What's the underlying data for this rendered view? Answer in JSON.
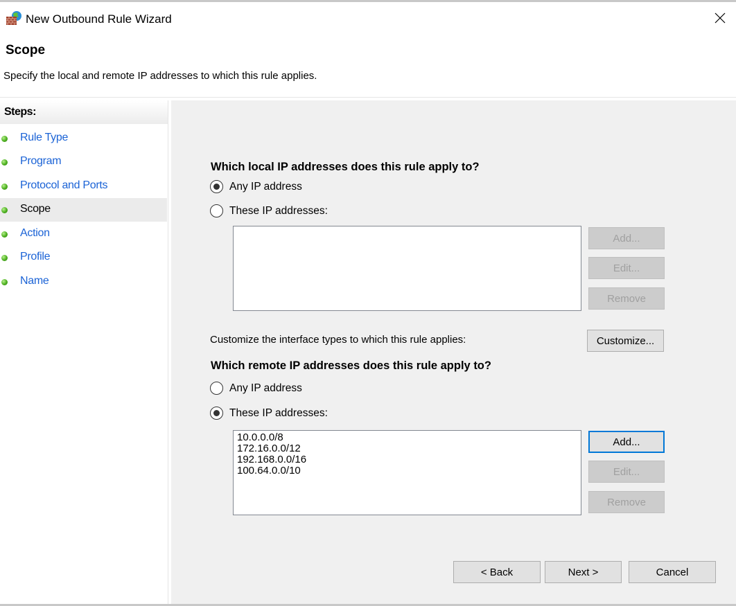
{
  "window": {
    "title": "New Outbound Rule Wizard",
    "icon": "firewall-globe-icon",
    "close_icon": "close-icon"
  },
  "header": {
    "title": "Scope",
    "description": "Specify the local and remote IP addresses to which this rule applies."
  },
  "steps": {
    "heading": "Steps:",
    "items": [
      {
        "label": "Rule Type",
        "active": false
      },
      {
        "label": "Program",
        "active": false
      },
      {
        "label": "Protocol and Ports",
        "active": false
      },
      {
        "label": "Scope",
        "active": true
      },
      {
        "label": "Action",
        "active": false
      },
      {
        "label": "Profile",
        "active": false
      },
      {
        "label": "Name",
        "active": false
      }
    ]
  },
  "local": {
    "question": "Which local IP addresses does this rule apply to?",
    "any_label": "Any IP address",
    "these_label": "These IP addresses:",
    "selected": "any",
    "addresses": [],
    "add_label": "Add...",
    "edit_label": "Edit...",
    "remove_label": "Remove"
  },
  "interface": {
    "text": "Customize the interface types to which this rule applies:",
    "button_label": "Customize..."
  },
  "remote": {
    "question": "Which remote IP addresses does this rule apply to?",
    "any_label": "Any IP address",
    "these_label": "These IP addresses:",
    "selected": "these",
    "addresses": [
      "10.0.0.0/8",
      "172.16.0.0/12",
      "192.168.0.0/16",
      "100.64.0.0/10"
    ],
    "add_label": "Add...",
    "edit_label": "Edit...",
    "remove_label": "Remove"
  },
  "footer": {
    "back_label": "< Back",
    "next_label": "Next >",
    "cancel_label": "Cancel"
  },
  "colors": {
    "link": "#1b63d6",
    "focus": "#0078d7",
    "panel_bg": "#f0f0f0"
  }
}
